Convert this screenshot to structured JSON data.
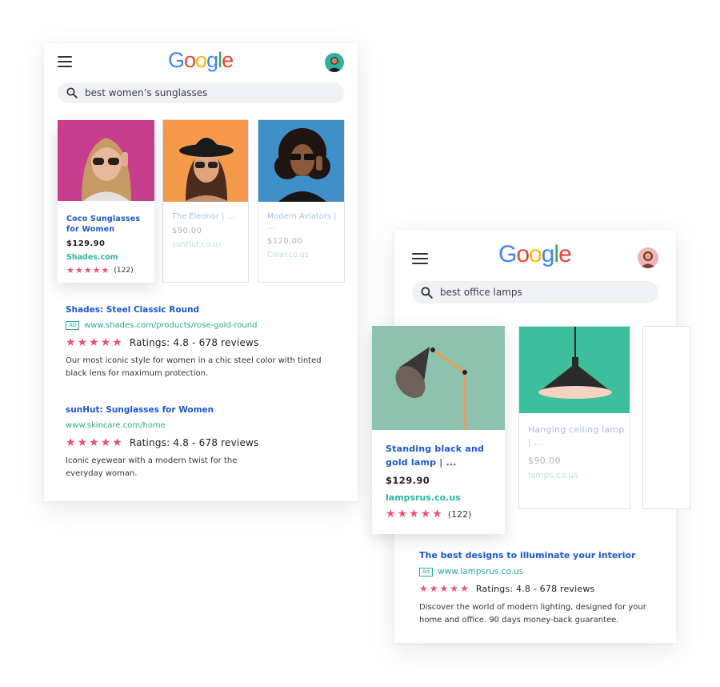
{
  "left": {
    "logo": [
      "G",
      "o",
      "o",
      "g",
      "l",
      "e"
    ],
    "logo_colors": [
      "#4285F4",
      "#EA4335",
      "#FBBC05",
      "#4285F4",
      "#34A853",
      "#EA4335"
    ],
    "search_query": "best women’s sunglasses",
    "products": [
      {
        "title": "Coco Sunglasses for Women",
        "price": "$129.90",
        "domain": "Shades.com",
        "rating_count": "(122)"
      },
      {
        "title": "The Eleonor | ...",
        "price": "$90.00",
        "domain": "sunHut.co.us"
      },
      {
        "title": "Modern Aviators | ...",
        "price": "$120.00",
        "domain": "Clear.co.us"
      }
    ],
    "results": [
      {
        "title": "Shades: Steel Classic Round",
        "ad_label": "Ad",
        "url": "www.shades.com/products/rose-gold-round",
        "rating": "Ratings: 4.8 - 678 reviews",
        "description": "Our most iconic style for women in a chic steel color with tinted black lens for maximum protection."
      },
      {
        "title": "sunHut: Sunglasses for Women",
        "url": "www.skincare.com/home",
        "rating": "Ratings: 4.8 - 678 reviews",
        "description": "Iconic eyewear with a modern twist for the everyday woman."
      }
    ]
  },
  "right": {
    "logo": [
      "G",
      "o",
      "o",
      "g",
      "l",
      "e"
    ],
    "search_query": "best office lamps",
    "products": [
      {
        "title": "Standing black and gold lamp | ...",
        "price": "$129.90",
        "domain": "lampsrus.co.us",
        "rating_count": "(122)"
      },
      {
        "title": "Hanging ceiling lamp | ...",
        "price": "$90.00",
        "domain": "lamps.co.us"
      }
    ],
    "results": [
      {
        "title": "The best designs to illuminate your interior",
        "ad_label": "Ad",
        "url": "www.lampsrus.co.us",
        "rating": "Ratings: 4.8 - 678 reviews",
        "description": "Discover the world of modern lighting, designed for your home and office. 90 days money-back guarantee."
      }
    ]
  },
  "colors": {
    "link": "#1a56db",
    "url": "#2aa896",
    "star": "#f0506e"
  }
}
